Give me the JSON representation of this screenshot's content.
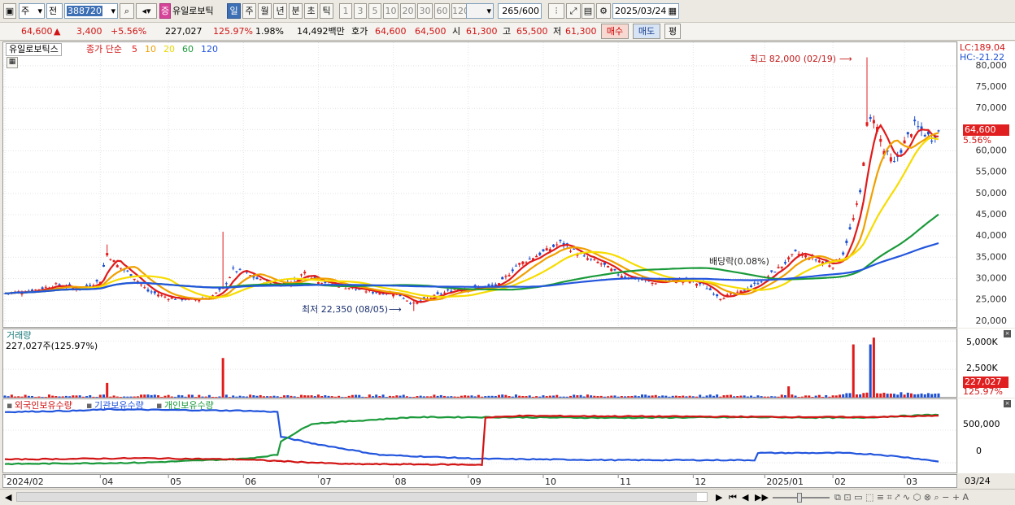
{
  "toolbar": {
    "market": "주",
    "scope": "전",
    "code": "388720",
    "stock_name": "유일로보틱",
    "badge": "증",
    "periods": [
      "일",
      "주",
      "월",
      "년",
      "분",
      "초",
      "틱"
    ],
    "selected_period": "일",
    "minute_options": [
      "1",
      "3",
      "5",
      "10",
      "20",
      "30",
      "60",
      "120"
    ],
    "count": "265",
    "count_max": "/600",
    "date": "2025/03/24"
  },
  "quote": {
    "price": "64,600",
    "arrow": "▲",
    "change": "3,400",
    "change_pct": "+5.56%",
    "volume": "227,027",
    "vol_ratio": "125.97%",
    "turnover": "1.98%",
    "amount": "14,492백만",
    "hoga_label": "호가",
    "ask": "64,600",
    "bid": "64,500",
    "open_label": "시",
    "open": "61,300",
    "high_label": "고",
    "high": "65,500",
    "low_label": "저",
    "low": "61,300",
    "buy_label": "매수",
    "sell_label": "매도",
    "eval_label": "평"
  },
  "legend": {
    "name": "유일로보틱스",
    "close_label": "종가 단순",
    "ma": [
      {
        "label": "5",
        "color": "#e01b1b"
      },
      {
        "label": "10",
        "color": "#f0a000"
      },
      {
        "label": "20",
        "color": "#e8d800"
      },
      {
        "label": "60",
        "color": "#1a9a3a"
      },
      {
        "label": "120",
        "color": "#2255dd"
      }
    ]
  },
  "annotations": {
    "high": "최고 82,000 (02/19)",
    "low": "최저 22,350 (08/05)",
    "dividend": "배당락(0.08%)"
  },
  "right_info": {
    "lc": "LC:189.04",
    "hc": "HC:-21.22",
    "price_tag": "64,600",
    "pct_tag": "5.56%",
    "vol_tag": "227,027",
    "vol_pct_tag": "125.97%"
  },
  "volume_panel": {
    "title": "거래량",
    "current": "227,027주(125.97%)",
    "ticks": [
      "5,000K",
      "2,500K"
    ]
  },
  "holder_panel": {
    "series": [
      {
        "label": "외국인보유수량",
        "color": "#d21313"
      },
      {
        "label": "기관보유수량",
        "color": "#2255dd"
      },
      {
        "label": "개인보유수량",
        "color": "#1a9a3a"
      }
    ],
    "ticks": [
      "500,000",
      "0"
    ]
  },
  "x_labels": [
    "2024/02",
    "04",
    "05",
    "06",
    "07",
    "08",
    "09",
    "10",
    "11",
    "12",
    "2025/01",
    "02",
    "03"
  ],
  "x_right": "03/24",
  "chart_data": {
    "type": "candlestick",
    "ylim": [
      19000,
      84000
    ],
    "yticks": [
      20000,
      25000,
      30000,
      35000,
      40000,
      45000,
      50000,
      55000,
      60000,
      65000,
      70000,
      75000,
      80000
    ],
    "ytick_labels": [
      "20,000",
      "25,000",
      "30,000",
      "35,000",
      "40,000",
      "45,000",
      "50,000",
      "55,000",
      "60,000",
      "65,000",
      "70,000",
      "75,000",
      "80,000"
    ],
    "close_anchors": [
      [
        0,
        26500
      ],
      [
        8,
        27200
      ],
      [
        15,
        28500
      ],
      [
        22,
        27500
      ],
      [
        28,
        29500
      ],
      [
        30,
        36000
      ],
      [
        33,
        33000
      ],
      [
        37,
        31000
      ],
      [
        42,
        27000
      ],
      [
        48,
        25500
      ],
      [
        55,
        25000
      ],
      [
        60,
        25500
      ],
      [
        64,
        27500
      ],
      [
        67,
        32000
      ],
      [
        70,
        31500
      ],
      [
        75,
        29500
      ],
      [
        80,
        28500
      ],
      [
        85,
        29500
      ],
      [
        88,
        31500
      ],
      [
        92,
        29500
      ],
      [
        100,
        28000
      ],
      [
        108,
        26800
      ],
      [
        115,
        26500
      ],
      [
        120,
        24000
      ],
      [
        125,
        25500
      ],
      [
        132,
        27500
      ],
      [
        140,
        27800
      ],
      [
        145,
        28500
      ],
      [
        150,
        33000
      ],
      [
        155,
        35000
      ],
      [
        160,
        37000
      ],
      [
        163,
        38500
      ],
      [
        166,
        37000
      ],
      [
        170,
        35000
      ],
      [
        175,
        33500
      ],
      [
        180,
        31000
      ],
      [
        185,
        30000
      ],
      [
        190,
        29000
      ],
      [
        195,
        29500
      ],
      [
        200,
        29500
      ],
      [
        205,
        28500
      ],
      [
        210,
        25500
      ],
      [
        215,
        26500
      ],
      [
        220,
        28500
      ],
      [
        223,
        30000
      ],
      [
        228,
        33000
      ],
      [
        232,
        36000
      ],
      [
        236,
        35000
      ],
      [
        240,
        34000
      ],
      [
        243,
        33000
      ],
      [
        246,
        36000
      ],
      [
        249,
        44000
      ],
      [
        251,
        50000
      ],
      [
        252,
        58000
      ],
      [
        253,
        66000
      ],
      [
        255,
        68000
      ],
      [
        258,
        60000
      ],
      [
        261,
        57000
      ],
      [
        264,
        62000
      ],
      [
        267,
        66000
      ],
      [
        270,
        64000
      ],
      [
        272,
        63000
      ],
      [
        274,
        64600
      ]
    ],
    "n_bars": 275,
    "ma_periods": [
      5,
      10,
      20,
      60,
      120
    ],
    "ma_colors": [
      "#e01b1b",
      "#f0a000",
      "#f7dc00",
      "#1a9a3a",
      "#2255dd"
    ],
    "volume_spikes": [
      [
        30,
        1300
      ],
      [
        64,
        3500
      ],
      [
        230,
        1000
      ],
      [
        249,
        4700
      ],
      [
        254,
        4700
      ],
      [
        255,
        5300
      ]
    ],
    "holders": {
      "foreign": [
        [
          0,
          50000
        ],
        [
          40,
          70000
        ],
        [
          70,
          50000
        ],
        [
          100,
          -20000
        ],
        [
          140,
          -30000
        ],
        [
          141,
          690000
        ],
        [
          150,
          720000
        ],
        [
          200,
          710000
        ],
        [
          250,
          700000
        ],
        [
          274,
          720000
        ]
      ],
      "institution": [
        [
          0,
          780000
        ],
        [
          22,
          800000
        ],
        [
          30,
          820000
        ],
        [
          70,
          800000
        ],
        [
          80,
          780000
        ],
        [
          81,
          400000
        ],
        [
          90,
          300000
        ],
        [
          110,
          120000
        ],
        [
          140,
          60000
        ],
        [
          180,
          40000
        ],
        [
          220,
          40000
        ],
        [
          221,
          150000
        ],
        [
          245,
          150000
        ],
        [
          255,
          130000
        ],
        [
          265,
          80000
        ],
        [
          274,
          20000
        ]
      ],
      "individual": [
        [
          0,
          -20000
        ],
        [
          40,
          0
        ],
        [
          70,
          60000
        ],
        [
          80,
          120000
        ],
        [
          81,
          330000
        ],
        [
          90,
          600000
        ],
        [
          120,
          700000
        ],
        [
          140,
          700000
        ],
        [
          180,
          690000
        ],
        [
          220,
          700000
        ],
        [
          250,
          690000
        ],
        [
          274,
          740000
        ]
      ]
    }
  }
}
